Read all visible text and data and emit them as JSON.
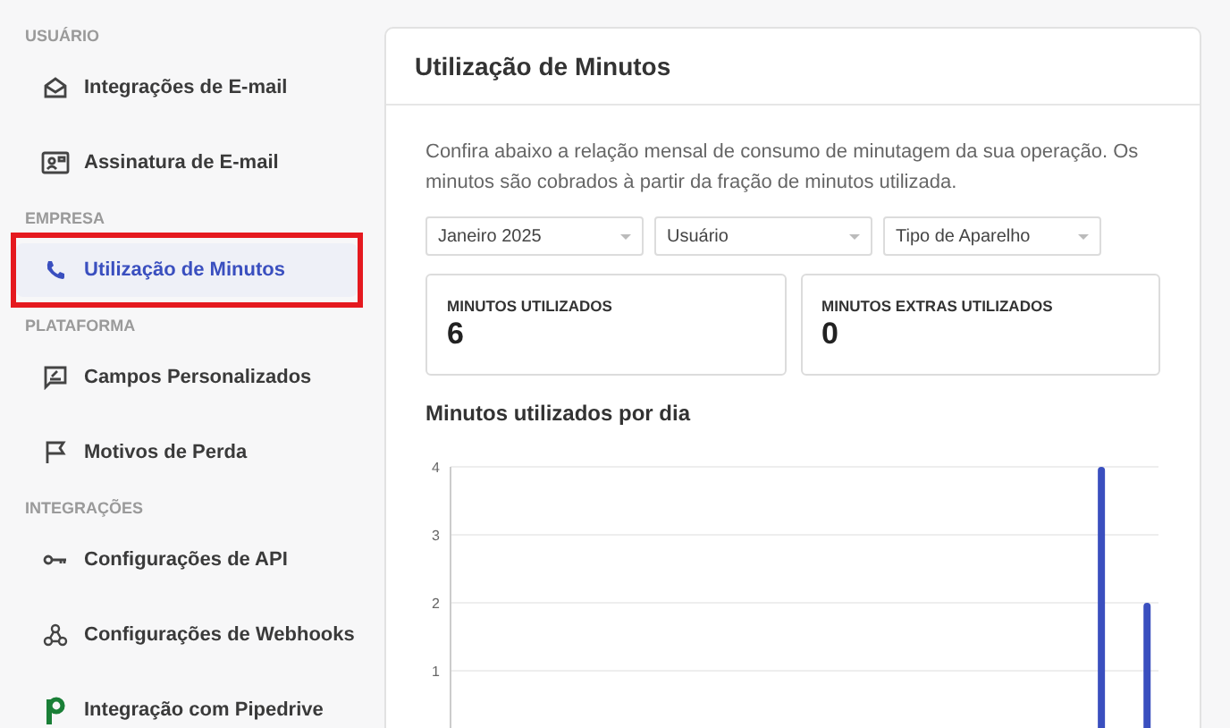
{
  "sidebar": {
    "sections": [
      {
        "title": "USUÁRIO",
        "items": [
          {
            "label": "Integrações de E-mail",
            "selected": false,
            "highlighted": false
          },
          {
            "label": "Assinatura de E-mail",
            "selected": false,
            "highlighted": false
          }
        ]
      },
      {
        "title": "EMPRESA",
        "items": [
          {
            "label": "Utilização de Minutos",
            "selected": true,
            "highlighted": true
          }
        ]
      },
      {
        "title": "PLATAFORMA",
        "items": [
          {
            "label": "Campos Personalizados",
            "selected": false,
            "highlighted": false
          },
          {
            "label": "Motivos de Perda",
            "selected": false,
            "highlighted": false
          }
        ]
      },
      {
        "title": "INTEGRAÇÕES",
        "items": [
          {
            "label": "Configurações de API",
            "selected": false,
            "highlighted": false
          },
          {
            "label": "Configurações de Webhooks",
            "selected": false,
            "highlighted": false
          },
          {
            "label": "Integração com Pipedrive",
            "selected": false,
            "highlighted": false
          }
        ]
      }
    ]
  },
  "panel": {
    "title": "Utilização de Minutos",
    "description": "Confira abaixo a relação mensal de consumo de minutagem da sua operação. Os minutos são cobrados à partir da fração de minutos utilizada.",
    "filters": [
      {
        "value": "Janeiro 2025"
      },
      {
        "value": "Usuário"
      },
      {
        "value": "Tipo de Aparelho"
      }
    ],
    "stats": [
      {
        "label": "MINUTOS UTILIZADOS",
        "value": "6"
      },
      {
        "label": "MINUTOS EXTRAS UTILIZADOS",
        "value": "0"
      }
    ],
    "chart_data": {
      "type": "bar",
      "title": "Minutos utilizados por dia",
      "ylim": [
        0,
        4
      ],
      "yticks": [
        1,
        2,
        3,
        4
      ],
      "grid": true,
      "series": [
        {
          "color": "#3a4fbf",
          "values": [
            0,
            0,
            0,
            0,
            0,
            0,
            0,
            0,
            0,
            0,
            0,
            0,
            0,
            0,
            0,
            0,
            0,
            0,
            0,
            0,
            0,
            0,
            0,
            0,
            0,
            0,
            0,
            0,
            4,
            0,
            2
          ]
        }
      ]
    }
  }
}
